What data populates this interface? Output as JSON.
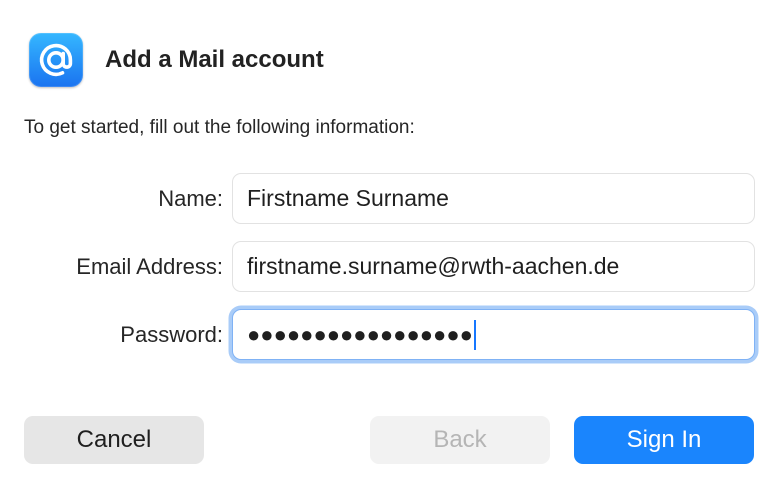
{
  "dialog": {
    "title": "Add a Mail account",
    "app_icon": "at-sign-icon",
    "intro": "To get started, fill out the following information:"
  },
  "form": {
    "name": {
      "label": "Name:",
      "value": "Firstname Surname"
    },
    "email": {
      "label": "Email Address:",
      "value": "firstname.surname@rwth-aachen.de"
    },
    "password": {
      "label": "Password:",
      "masked_value": "●●●●●●●●●●●●●●●●●",
      "focused": true
    }
  },
  "buttons": {
    "cancel": "Cancel",
    "back": "Back",
    "back_disabled": true,
    "sign_in": "Sign In"
  },
  "colors": {
    "accent": "#1a85fd",
    "focus_ring": "#a9ccf8",
    "icon_gradient_top": "#35b7ff",
    "icon_gradient_bottom": "#1a73f0"
  }
}
